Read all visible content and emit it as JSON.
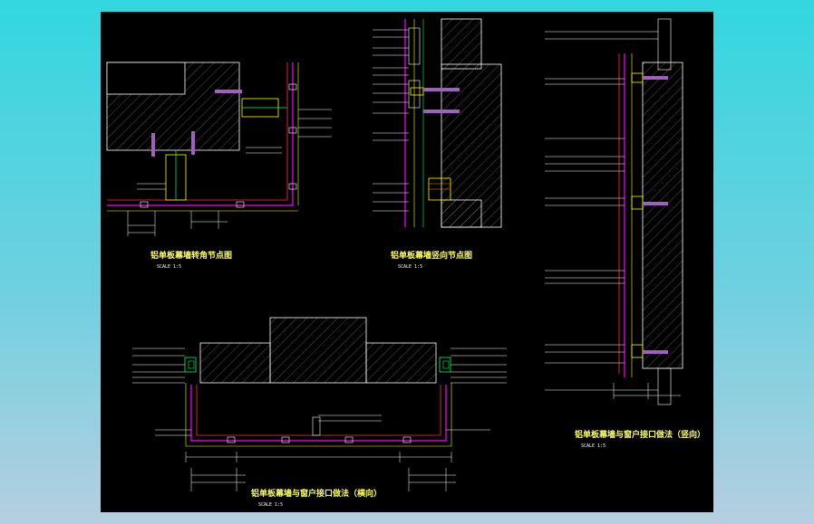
{
  "drawing": {
    "background": "#000000",
    "viewer_background": "#33d7df",
    "colors": {
      "leader_lines": "#ffffff",
      "secondary_lines": "#00ff66",
      "panel_outline": "#ff00ff",
      "frame_lines": "#ffff00",
      "concrete": "#ffffff",
      "annotations": "#ffffff"
    }
  },
  "details": [
    {
      "title": "铝单板幕墙转角节点图",
      "scale": "SCALE 1:5"
    },
    {
      "title": "铝单板幕墙竖向节点图",
      "scale": "SCALE 1:5"
    },
    {
      "title": "铝单板幕墙与窗户接口做法（竖向）",
      "scale": "SCALE 1:5"
    },
    {
      "title": "铝单板幕墙与窗户接口做法（横向）",
      "scale": "SCALE 1:5"
    }
  ]
}
